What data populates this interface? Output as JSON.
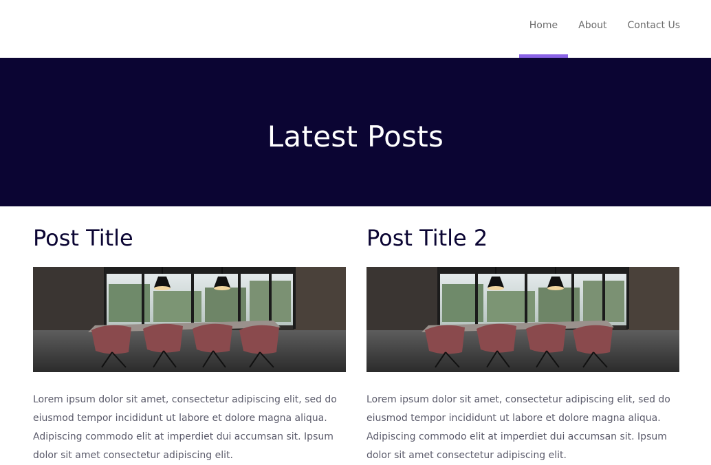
{
  "nav": {
    "items": [
      {
        "label": "Home",
        "active": true
      },
      {
        "label": "About",
        "active": false
      },
      {
        "label": "Contact Us",
        "active": false
      }
    ],
    "accent_color": "#8a63e6"
  },
  "hero": {
    "title": "Latest Posts",
    "background": "#0b0533"
  },
  "posts": [
    {
      "title": "Post Title",
      "image": "conference-room-photo",
      "excerpt": "Lorem ipsum dolor sit amet, consectetur adipiscing elit, sed do eiusmod tempor incididunt ut labore et dolore magna aliqua. Adipiscing commodo elit at imperdiet dui accumsan sit. Ipsum dolor sit amet consectetur adipiscing elit."
    },
    {
      "title": "Post Title 2",
      "image": "conference-room-photo",
      "excerpt": "Lorem ipsum dolor sit amet, consectetur adipiscing elit, sed do eiusmod tempor incididunt ut labore et dolore magna aliqua. Adipiscing commodo elit at imperdiet dui accumsan sit. Ipsum dolor sit amet consectetur adipiscing elit."
    }
  ]
}
